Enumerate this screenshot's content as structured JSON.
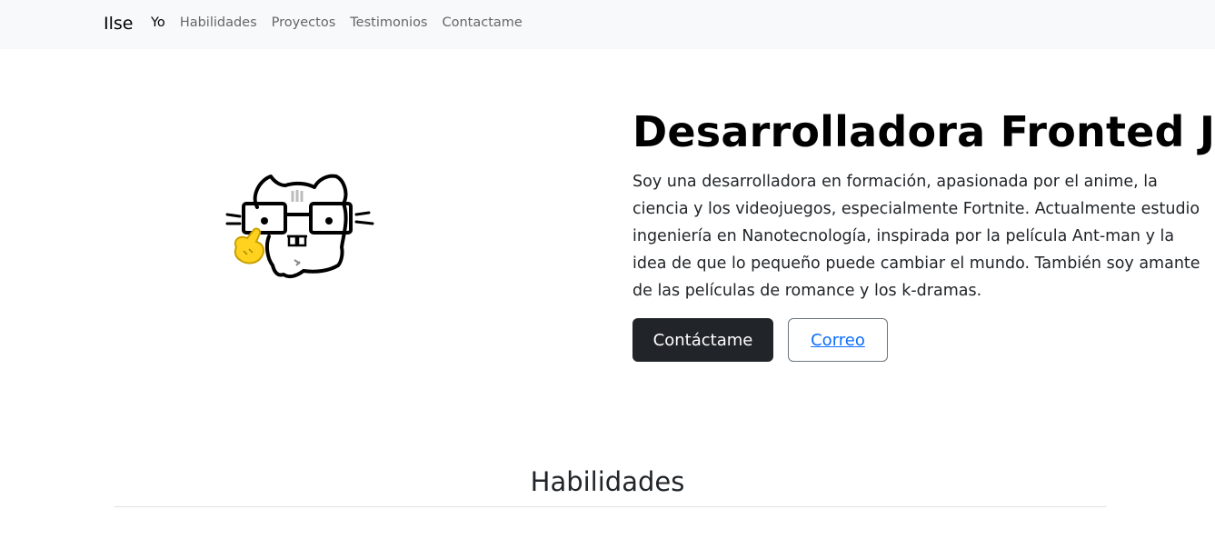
{
  "navbar": {
    "brand": "Ilse",
    "links": [
      {
        "label": "Yo"
      },
      {
        "label": "Habilidades"
      },
      {
        "label": "Proyectos"
      },
      {
        "label": "Testimonios"
      },
      {
        "label": "Contactame"
      }
    ]
  },
  "hero": {
    "image": "cat-with-glasses-pointing-icon",
    "title": "Desarrolladora Fronted JR",
    "description": "Soy una desarrolladora en formación, apasionada por el anime, la ciencia y los videojuegos, especialmente Fortnite. Actualmente estudio ingeniería en Nanotecnología, inspirada por la película Ant-man y la idea de que lo pequeño puede cambiar el mundo. También soy amante de las películas de romance y los k-dramas.",
    "contact_button": "Contáctame",
    "email_button": "Correo"
  },
  "skills": {
    "title": "Habilidades"
  }
}
